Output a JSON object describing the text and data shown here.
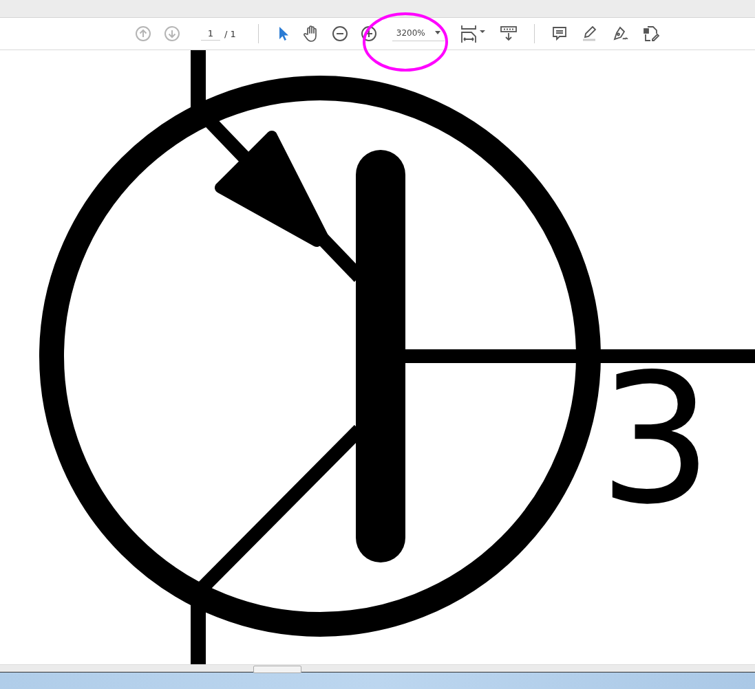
{
  "toolbar": {
    "page_buttons": [
      {
        "kind": "previous",
        "disabled": true
      },
      {
        "kind": "next",
        "disabled": true
      }
    ],
    "page_number": "1",
    "page_total": "/ 1",
    "tools": [
      {
        "kind": "select",
        "selected": true
      },
      {
        "kind": "hand",
        "selected": false
      }
    ],
    "zoom": "3200%"
  },
  "document": {
    "symbol_label": "3"
  }
}
